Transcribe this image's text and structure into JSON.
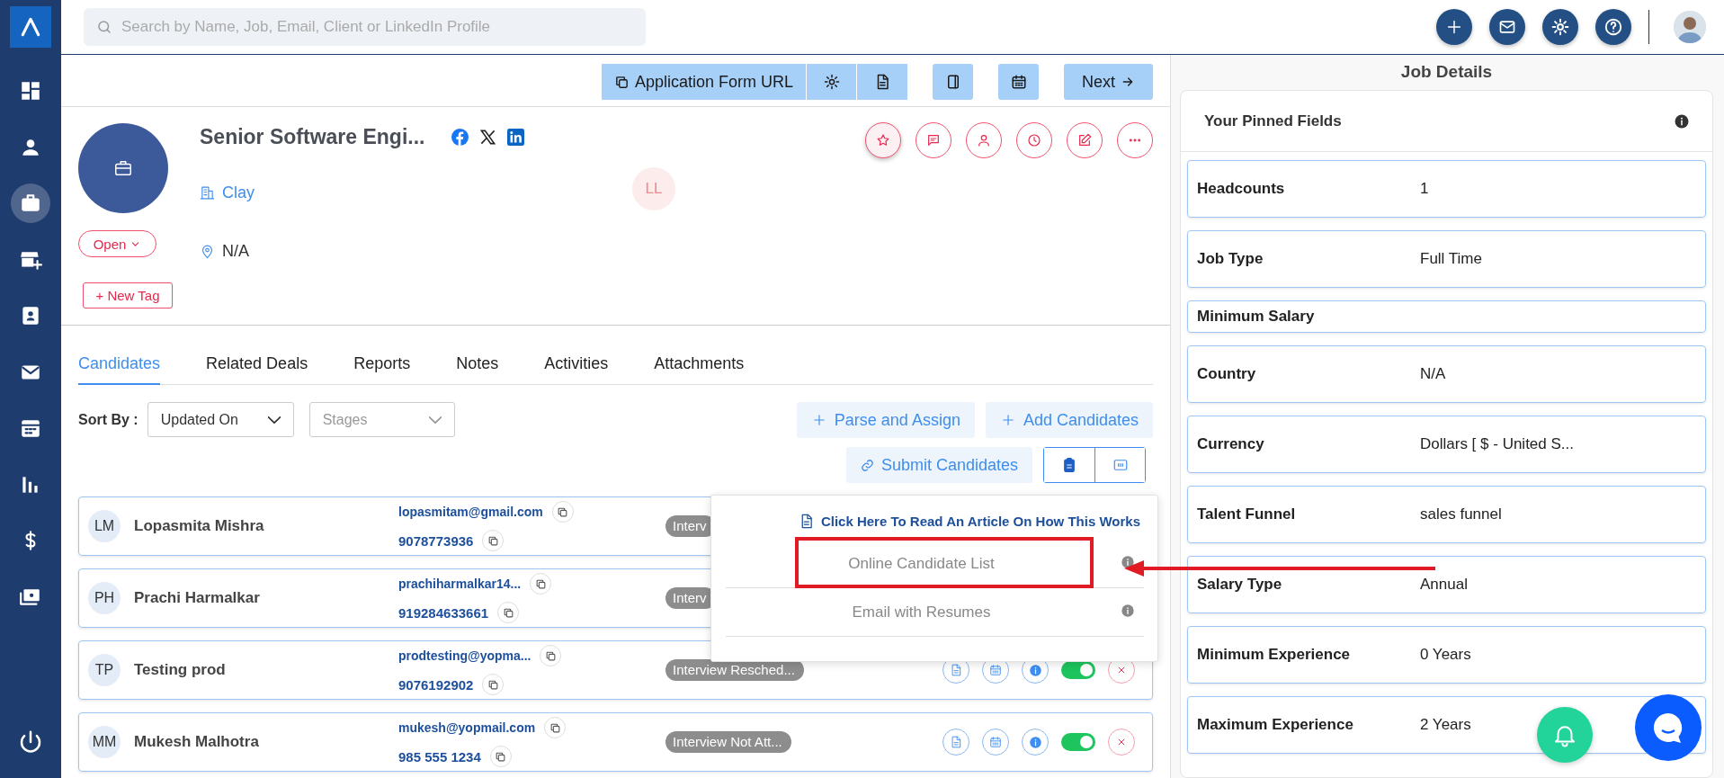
{
  "sidebar": {
    "items": [
      {
        "selected": false
      },
      {
        "selected": false
      },
      {
        "selected": true
      },
      {
        "selected": false
      },
      {
        "selected": false
      },
      {
        "selected": false
      },
      {
        "selected": false
      },
      {
        "selected": false
      },
      {
        "selected": false
      },
      {
        "selected": false
      }
    ]
  },
  "search": {
    "placeholder": "Search by Name, Job, Email, Client or LinkedIn Profile"
  },
  "toolbar": {
    "application_form_url": "Application Form URL",
    "next": "Next"
  },
  "job": {
    "title": "Senior Software Engi...",
    "company": "Clay",
    "location": "N/A",
    "status": "Open",
    "new_tag": "+ New Tag",
    "owner_initials": "LL"
  },
  "tabs": [
    {
      "label": "Candidates",
      "selected": true
    },
    {
      "label": "Related Deals",
      "selected": false
    },
    {
      "label": "Reports",
      "selected": false
    },
    {
      "label": "Notes",
      "selected": false
    },
    {
      "label": "Activities",
      "selected": false
    },
    {
      "label": "Attachments",
      "selected": false
    }
  ],
  "sort": {
    "label": "Sort By :",
    "sort_field": "Updated On",
    "stage_placeholder": "Stages"
  },
  "actions": {
    "parse_and_assign": "Parse and Assign",
    "add_candidates": "Add Candidates",
    "submit_candidates": "Submit Candidates"
  },
  "view_modes": [
    {
      "selected": true
    },
    {
      "selected": false
    }
  ],
  "candidates": [
    {
      "initials": "LM",
      "name": "Lopasmita Mishra",
      "email": "lopasmitam@gmail.com",
      "phone": "9078773936",
      "stage": "Interv"
    },
    {
      "initials": "PH",
      "name": "Prachi Harmalkar",
      "email": "prachiharmalkar14...",
      "phone": "919284633661",
      "stage": "Interv"
    },
    {
      "initials": "TP",
      "name": "Testing prod",
      "email": "prodtesting@yopma...",
      "phone": "9076192902",
      "stage": "Interview Resched...",
      "enabled": true
    },
    {
      "initials": "MM",
      "name": "Mukesh Malhotra",
      "email": "mukesh@yopmail.com",
      "phone": "985 555 1234",
      "stage": "Interview Not Att...",
      "enabled": true
    }
  ],
  "submit_menu": {
    "article_link": "Click Here To Read An Article On How This Works",
    "options": [
      {
        "label": "Online Candidate List",
        "highlighted": true
      },
      {
        "label": "Email with Resumes",
        "highlighted": false
      }
    ]
  },
  "job_details": {
    "title": "Job Details",
    "pinned_title": "Your Pinned Fields",
    "fields": [
      {
        "label": "Headcounts",
        "value": "1"
      },
      {
        "label": "Job Type",
        "value": "Full Time"
      },
      {
        "label": "Minimum Salary"
      },
      {
        "label": "Country",
        "value": "N/A"
      },
      {
        "label": "Currency",
        "value": "Dollars [ $ - United S..."
      },
      {
        "label": "Talent Funnel",
        "value": "sales funnel"
      },
      {
        "label": "Salary Type",
        "value": "Annual"
      },
      {
        "label": "Minimum Experience",
        "value": "0 Years"
      },
      {
        "label": "Maximum Experience",
        "value": "2 Years"
      }
    ]
  }
}
